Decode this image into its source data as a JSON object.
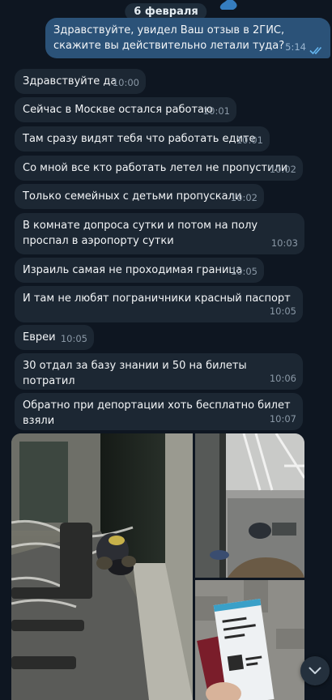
{
  "date_label": "6 февраля",
  "outgoing": {
    "text": "Здравствуйте, увидел Ваш отзыв в 2ГИС, скажите вы действительно летали туда?",
    "time": "5:14",
    "status_icon": "double-check-icon"
  },
  "incoming": [
    {
      "text": "Здравствуйте да",
      "time": "10:00"
    },
    {
      "text": "Сейчас в Москве остался работаю",
      "time": "10:01"
    },
    {
      "text": "Там сразу видят тебя что работать едите",
      "time": "10:01"
    },
    {
      "text": "Со мной все кто работать летел не пропустили",
      "time": "10:02"
    },
    {
      "text": "Только семейных с детьми пропускали",
      "time": "10:02"
    },
    {
      "text": "В комнате допроса сутки и потом на полу проспал в аэропорту сутки",
      "time": "10:03"
    },
    {
      "text": "Израиль самая не проходимая граница",
      "time": "10:05"
    },
    {
      "text": "И там не любят пограничники красный паспорт",
      "time": "10:05"
    },
    {
      "text": "Евреи",
      "time": "10:05"
    },
    {
      "text": "30 отдал за базу знании и 50 на билеты потратил",
      "time": "10:06"
    },
    {
      "text": "Обратно при депортации хоть бесплатно билет взяли",
      "time": "10:07"
    }
  ],
  "colors": {
    "background": "#0e1621",
    "incoming_bubble": "#1c2733",
    "outgoing_bubble": "#2b5278",
    "time_text": "#8a98a6",
    "tick_color": "#64b5ef"
  },
  "scroll_button_icon": "chevron-down-icon"
}
